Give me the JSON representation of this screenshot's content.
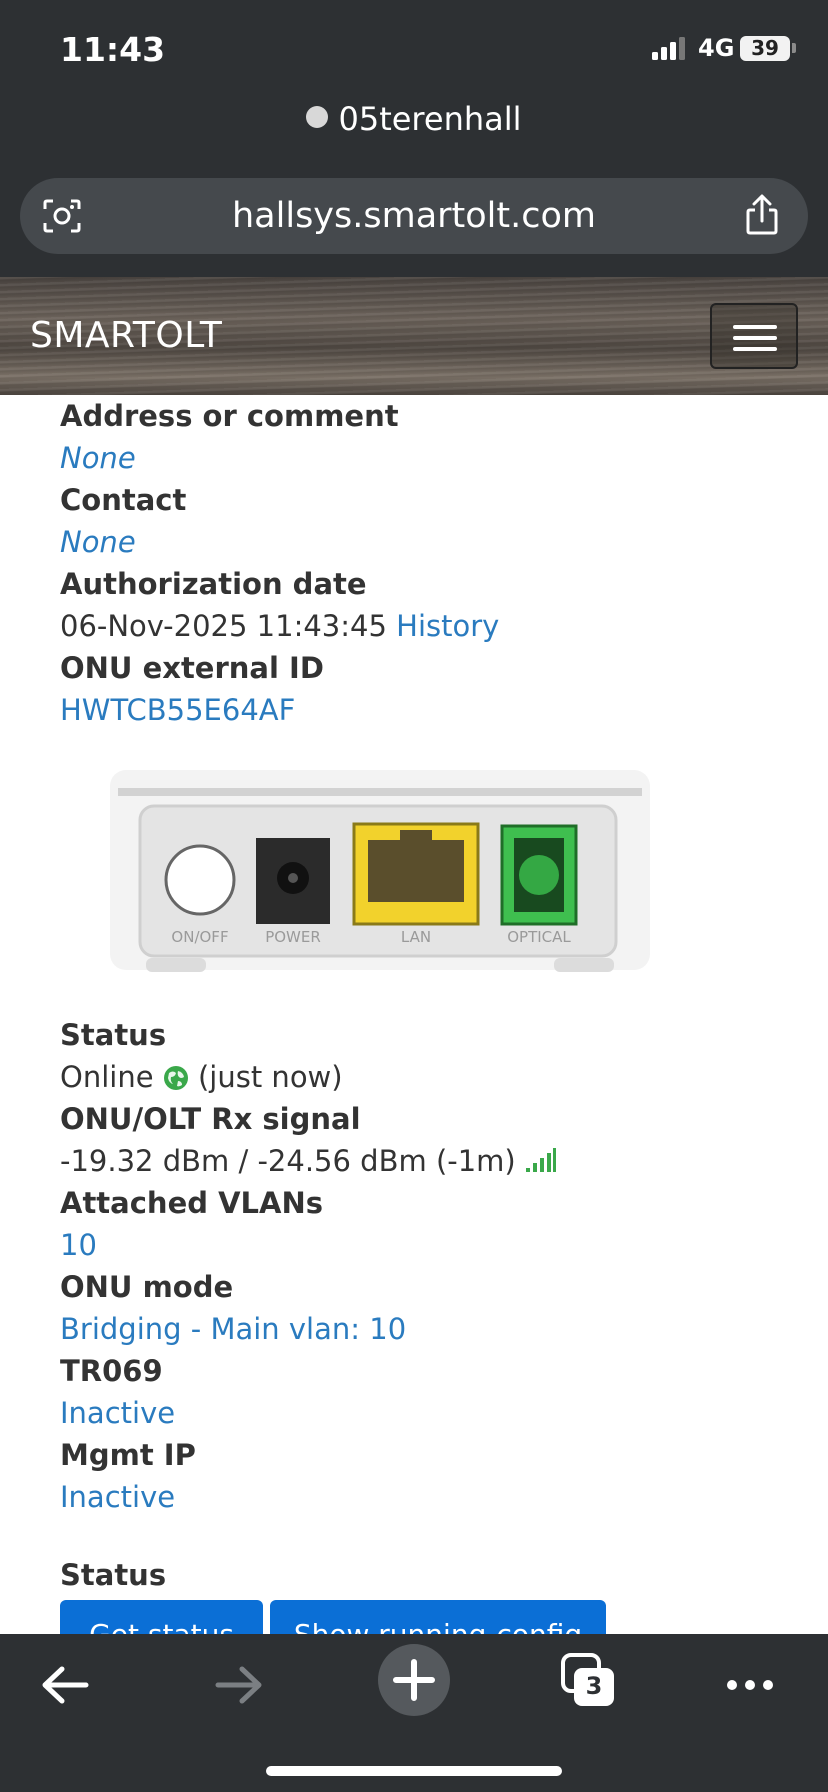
{
  "status_bar": {
    "time": "11:43",
    "network": "4G",
    "battery": "39"
  },
  "browser": {
    "tab_title": "05terenhall",
    "url": "hallsys.smartolt.com",
    "tabs_count": "3"
  },
  "site": {
    "brand": "SMARTOLT"
  },
  "details": {
    "address_label": "Address or comment",
    "address_value": "None",
    "contact_label": "Contact",
    "contact_value": "None",
    "auth_label": "Authorization date",
    "auth_value": "06-Nov-2025 11:43:45",
    "history_link": "History",
    "ext_id_label": "ONU external ID",
    "ext_id_value": "HWTCB55E64AF"
  },
  "device_ports": [
    "ON/OFF",
    "POWER",
    "LAN",
    "OPTICAL"
  ],
  "status": {
    "status_label": "Status",
    "status_value": "Online",
    "status_time": "(just now)",
    "rx_label": "ONU/OLT Rx signal",
    "rx_value": "-19.32 dBm / -24.56 dBm (-1m)",
    "vlans_label": "Attached VLANs",
    "vlans_value": "10",
    "mode_label": "ONU mode",
    "mode_value": "Bridging - Main vlan: 10",
    "tr069_label": "TR069",
    "tr069_value": "Inactive",
    "mgmt_label": "Mgmt IP",
    "mgmt_value": "Inactive"
  },
  "actions": {
    "section_title": "Status",
    "get_status": "Get status",
    "show_config": "Show running-config"
  },
  "colors": {
    "link": "#2a7bbf",
    "button": "#0b6fd6",
    "chrome": "#2d3033",
    "online": "#3aa84a"
  }
}
